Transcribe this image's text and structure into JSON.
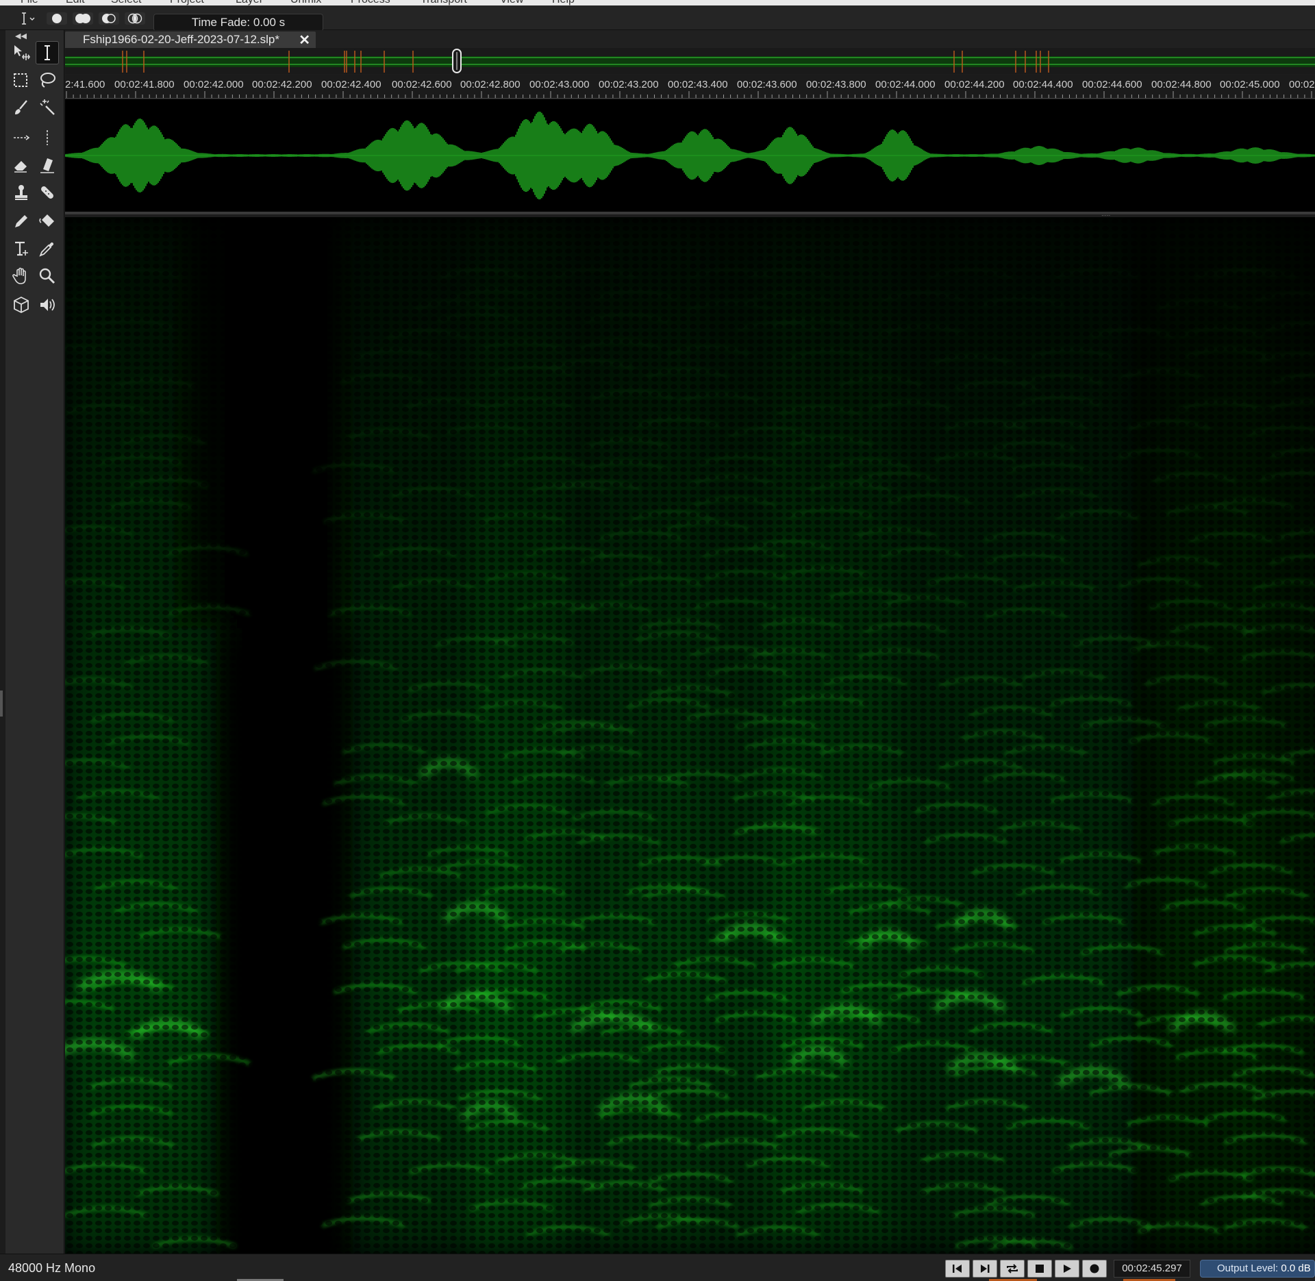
{
  "menu": {
    "items": [
      "File",
      "Edit",
      "Select",
      "Project",
      "Layer",
      "Unmix",
      "Process",
      "Transport",
      "View",
      "Help"
    ]
  },
  "toolbar": {
    "time_fade_label": "Time Fade: 0.00 s"
  },
  "tools": [
    "time-range-icon",
    "time-select-icon",
    "rect-select-icon",
    "lasso-icon",
    "brush-select-icon",
    "magic-wand-icon",
    "freq-select-icon",
    "time-freq-select-icon",
    "eraser-icon",
    "smart-eraser-icon",
    "clone-stamp-icon",
    "bandage-icon",
    "pencil-icon",
    "paint-bucket-icon",
    "text-tool-icon",
    "eyedropper-icon",
    "hand-icon",
    "zoom-icon",
    "cube-icon",
    "speaker-icon"
  ],
  "file_tab": {
    "name": "Fship1966-02-20-Jeff-2023-07-12.slp*",
    "close_label": "✕"
  },
  "ruler": {
    "labels": [
      "2:41.600",
      "00:02:41.800",
      "00:02:42.000",
      "00:02:42.200",
      "00:02:42.400",
      "00:02:42.600",
      "00:02:42.800",
      "00:02:43.000",
      "00:02:43.200",
      "00:02:43.400",
      "00:02:43.600",
      "00:02:43.800",
      "00:02:44.000",
      "00:02:44.200",
      "00:02:44.400",
      "00:02:44.600",
      "00:02:44.800",
      "00:02:45.000",
      "00:02"
    ]
  },
  "status": {
    "format": "48000 Hz Mono",
    "timecode": "00:02:45.297",
    "output_level_label": "Output Level:",
    "output_level_value": "0.0 dB"
  },
  "colors": {
    "waveform": "#1f9e1f",
    "spectrogram": "#22d622",
    "marker": "#b8581c",
    "output_level_bg": "#2f4d73"
  }
}
